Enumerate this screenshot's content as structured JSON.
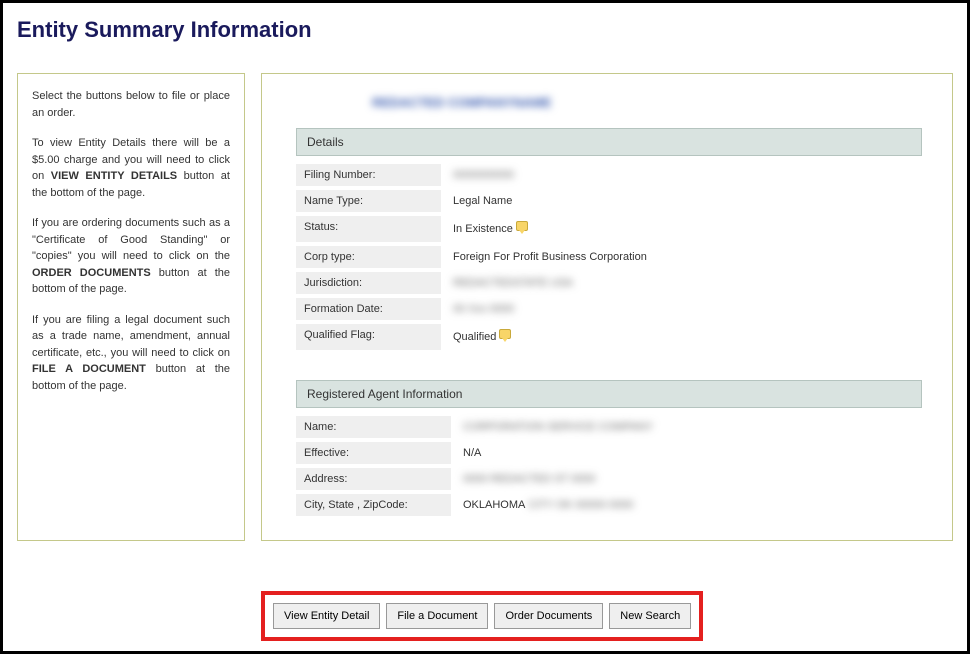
{
  "page_title": "Entity Summary Information",
  "sidebar": {
    "p1": "Select the buttons below to file or place an order.",
    "p2a": "To view Entity Details there will be a $5.00 charge and you will need to click on ",
    "p2b": "VIEW ENTITY DETAILS",
    "p2c": " button at the bottom of the page.",
    "p3a": "If you are ordering documents such as a \"Certificate of Good Standing\" or \"copies\" you will need to click on the ",
    "p3b": "ORDER DOCUMENTS",
    "p3c": " button at the bottom of the page.",
    "p4a": "If you are filing a legal document such as a trade name, amendment, annual certificate, etc., you will need to click on ",
    "p4b": "FILE A DOCUMENT",
    "p4c": " button at the bottom of the page."
  },
  "entity_name": "REDACTED COMPANYNAME",
  "sections": {
    "details_header": "Details",
    "agent_header": "Registered Agent Information"
  },
  "details": {
    "filing_number_label": "Filing Number:",
    "filing_number_value": "0000000000",
    "name_type_label": "Name Type:",
    "name_type_value": "Legal Name",
    "status_label": "Status:",
    "status_value": "In Existence",
    "corp_type_label": "Corp type:",
    "corp_type_value": "Foreign For Profit Business Corporation",
    "jurisdiction_label": "Jurisdiction:",
    "jurisdiction_value": "REDACTEDSTATE USA",
    "formation_date_label": "Formation Date:",
    "formation_date_value": "00 Xxx 0000",
    "qualified_flag_label": "Qualified Flag:",
    "qualified_flag_value": "Qualified"
  },
  "agent": {
    "name_label": "Name:",
    "name_value": "CORPORATION SERVICE COMPANY",
    "effective_label": "Effective:",
    "effective_value": "N/A",
    "address_label": "Address:",
    "address_value": "0000 REDACTED ST 0000",
    "city_label": "City, State , ZipCode:",
    "city_value_prefix": "OKLAHOMA",
    "city_value_rest": "CITY  OK  00000 0000"
  },
  "buttons": {
    "view_entity": "View Entity Detail",
    "file_doc": "File a Document",
    "order_docs": "Order Documents",
    "new_search": "New Search"
  }
}
